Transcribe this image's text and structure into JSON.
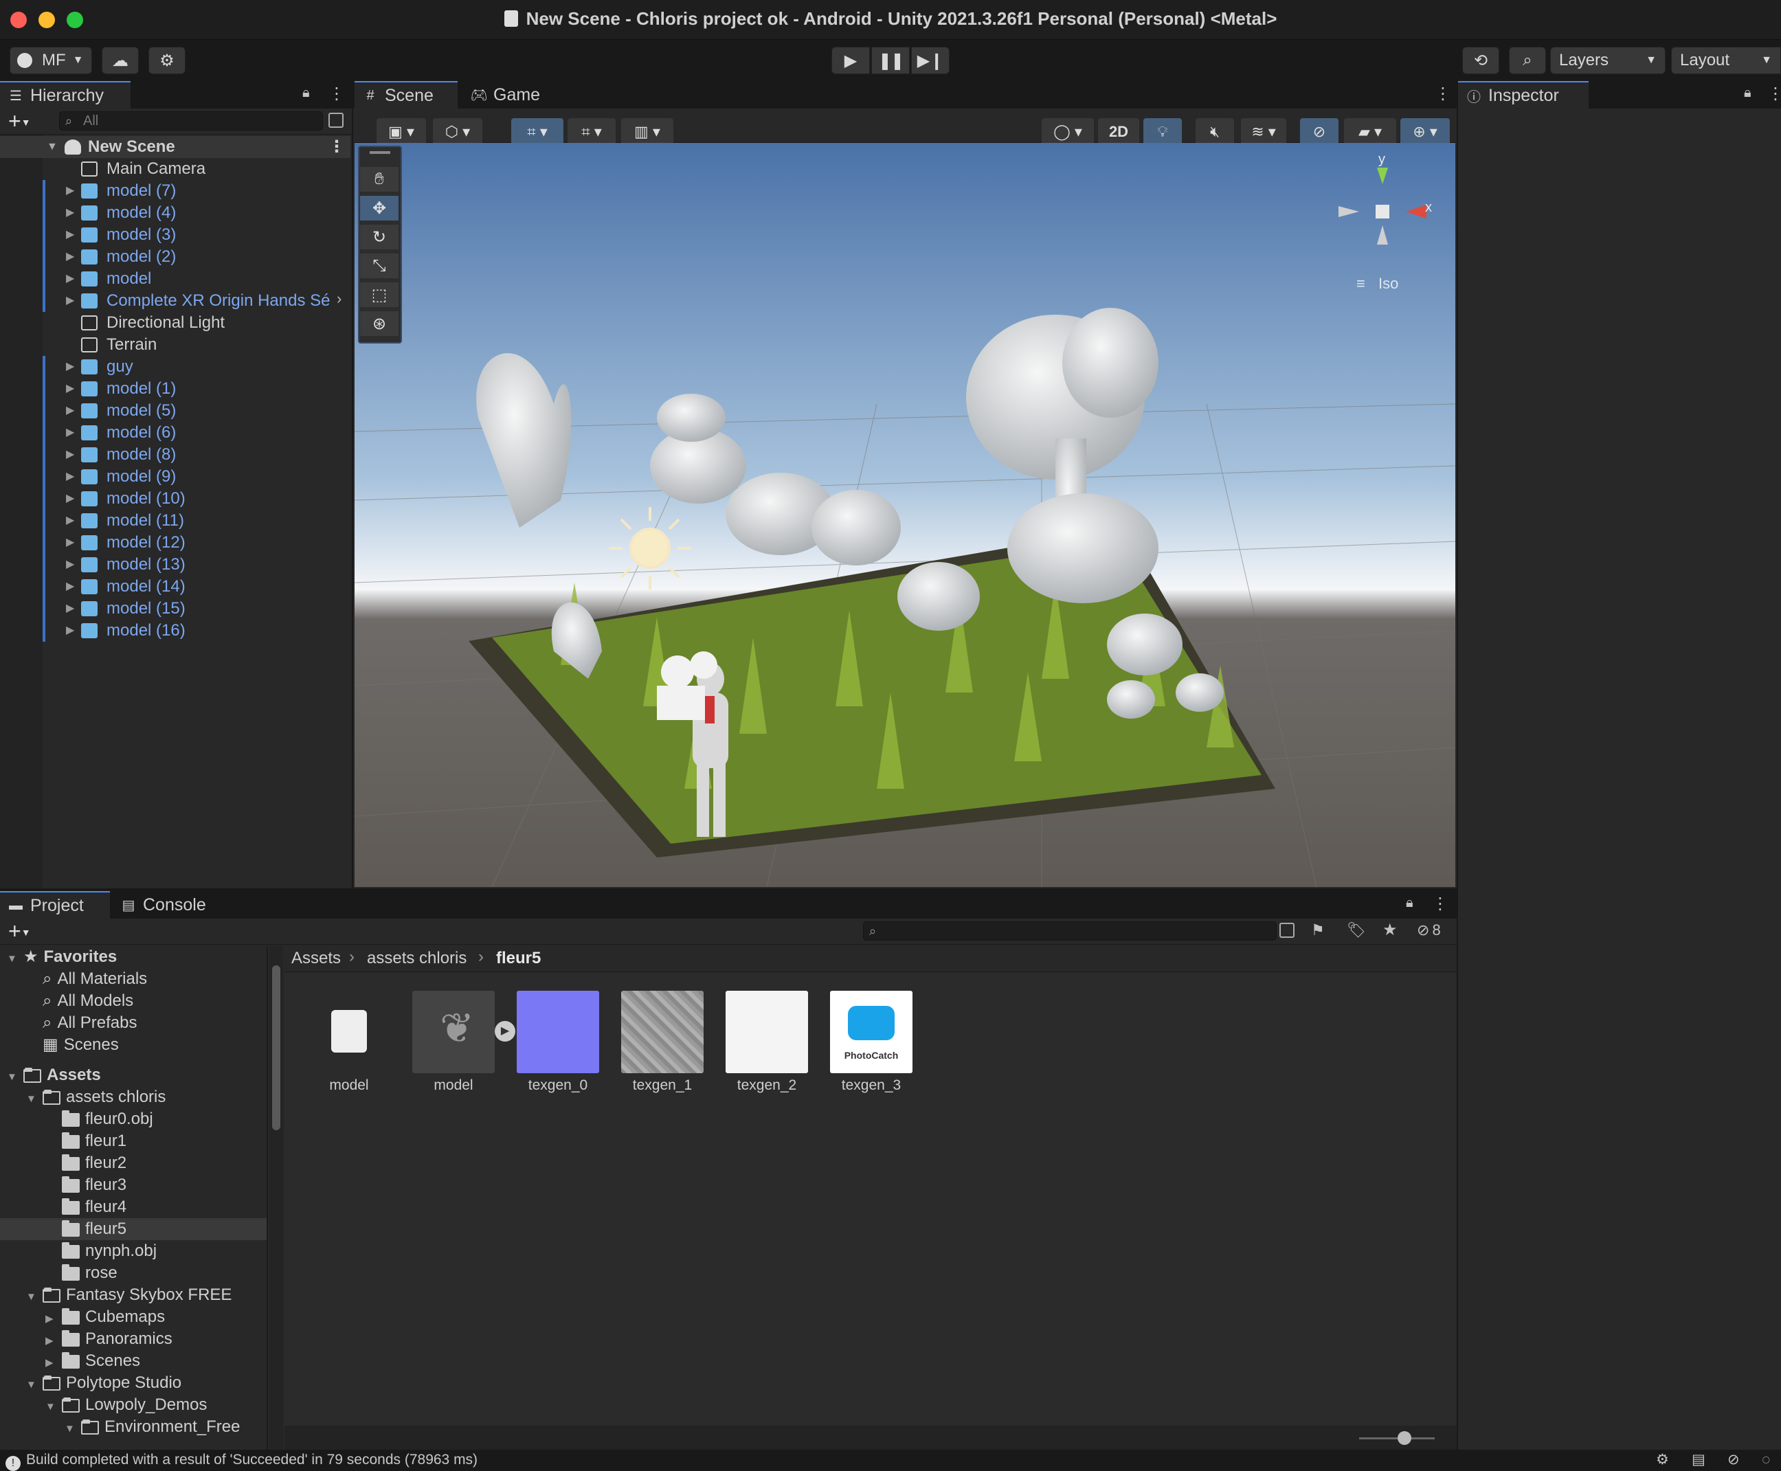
{
  "window": {
    "title": "New Scene - Chloris project ok - Android - Unity 2021.3.26f1 Personal (Personal) <Metal>"
  },
  "toolbar": {
    "account_label": "MF",
    "layers_label": "Layers",
    "layout_label": "Layout"
  },
  "hierarchy": {
    "tab_label": "Hierarchy",
    "search_placeholder": "All",
    "scene_name": "New Scene",
    "items": [
      {
        "label": "Main Camera",
        "prefab": false,
        "expandable": false
      },
      {
        "label": "model (7)",
        "prefab": true,
        "expandable": true
      },
      {
        "label": "model (4)",
        "prefab": true,
        "expandable": true
      },
      {
        "label": "model (3)",
        "prefab": true,
        "expandable": true
      },
      {
        "label": "model (2)",
        "prefab": true,
        "expandable": true
      },
      {
        "label": "model",
        "prefab": true,
        "expandable": true
      },
      {
        "label": "Complete XR Origin Hands Sé",
        "prefab": true,
        "expandable": true
      },
      {
        "label": "Directional Light",
        "prefab": false,
        "expandable": false
      },
      {
        "label": "Terrain",
        "prefab": false,
        "expandable": false
      },
      {
        "label": "guy",
        "prefab": true,
        "expandable": true
      },
      {
        "label": "model (1)",
        "prefab": true,
        "expandable": true
      },
      {
        "label": "model (5)",
        "prefab": true,
        "expandable": true
      },
      {
        "label": "model (6)",
        "prefab": true,
        "expandable": true
      },
      {
        "label": "model (8)",
        "prefab": true,
        "expandable": true
      },
      {
        "label": "model (9)",
        "prefab": true,
        "expandable": true
      },
      {
        "label": "model (10)",
        "prefab": true,
        "expandable": true
      },
      {
        "label": "model (11)",
        "prefab": true,
        "expandable": true
      },
      {
        "label": "model (12)",
        "prefab": true,
        "expandable": true
      },
      {
        "label": "model (13)",
        "prefab": true,
        "expandable": true
      },
      {
        "label": "model (14)",
        "prefab": true,
        "expandable": true
      },
      {
        "label": "model (15)",
        "prefab": true,
        "expandable": true
      },
      {
        "label": "model (16)",
        "prefab": true,
        "expandable": true
      }
    ]
  },
  "scene_view": {
    "tabs": [
      "Scene",
      "Game"
    ],
    "mode_2d": "2D",
    "gizmo_y": "y",
    "gizmo_x": "x",
    "projection": "Iso"
  },
  "inspector": {
    "tab_label": "Inspector"
  },
  "project": {
    "tabs": [
      "Project",
      "Console"
    ],
    "hidden_count": "8",
    "breadcrumb": [
      "Assets",
      "assets chloris",
      "fleur5"
    ],
    "tree": [
      {
        "label": "Favorites",
        "kind": "star",
        "level": 0,
        "bold": true,
        "arrow": "down"
      },
      {
        "label": "All Materials",
        "kind": "search",
        "level": 1
      },
      {
        "label": "All Models",
        "kind": "search",
        "level": 1
      },
      {
        "label": "All Prefabs",
        "kind": "search",
        "level": 1
      },
      {
        "label": "Scenes",
        "kind": "scene",
        "level": 1
      },
      {
        "label": "Assets",
        "kind": "folder-open",
        "level": 0,
        "bold": true,
        "arrow": "down",
        "gap": true
      },
      {
        "label": "assets chloris",
        "kind": "folder-open",
        "level": 1,
        "arrow": "down"
      },
      {
        "label": "fleur0.obj",
        "kind": "folder",
        "level": 2
      },
      {
        "label": "fleur1",
        "kind": "folder",
        "level": 2
      },
      {
        "label": "fleur2",
        "kind": "folder",
        "level": 2
      },
      {
        "label": "fleur3",
        "kind": "folder",
        "level": 2
      },
      {
        "label": "fleur4",
        "kind": "folder",
        "level": 2
      },
      {
        "label": "fleur5",
        "kind": "folder",
        "level": 2,
        "selected": true
      },
      {
        "label": "nynph.obj",
        "kind": "folder",
        "level": 2
      },
      {
        "label": "rose",
        "kind": "folder",
        "level": 2
      },
      {
        "label": "Fantasy Skybox FREE",
        "kind": "folder-open",
        "level": 1,
        "arrow": "down"
      },
      {
        "label": "Cubemaps",
        "kind": "folder",
        "level": 2,
        "arrow": "right"
      },
      {
        "label": "Panoramics",
        "kind": "folder",
        "level": 2,
        "arrow": "right"
      },
      {
        "label": "Scenes",
        "kind": "folder",
        "level": 2,
        "arrow": "right"
      },
      {
        "label": "Polytope Studio",
        "kind": "folder-open",
        "level": 1,
        "arrow": "down"
      },
      {
        "label": "Lowpoly_Demos",
        "kind": "folder-open",
        "level": 2,
        "arrow": "down"
      },
      {
        "label": "Environment_Free",
        "kind": "folder-open",
        "level": 3,
        "arrow": "down"
      }
    ],
    "assets": [
      {
        "label": "model",
        "kind": "prefab"
      },
      {
        "label": "model",
        "kind": "mesh"
      },
      {
        "label": "texgen_0",
        "kind": "normal",
        "color": "#7b78f5"
      },
      {
        "label": "texgen_1",
        "kind": "stone"
      },
      {
        "label": "texgen_2",
        "kind": "white"
      },
      {
        "label": "texgen_3",
        "kind": "photocatch",
        "logo_text": "PhotoCatch"
      }
    ]
  },
  "status_bar": {
    "message": "Build completed with a result of 'Succeeded' in 79 seconds (78963 ms)"
  },
  "colors": {
    "accent": "#4d8cf5",
    "prefab_blue": "#7ca7ef",
    "panel_bg": "#282828",
    "header_bg": "#191919"
  }
}
